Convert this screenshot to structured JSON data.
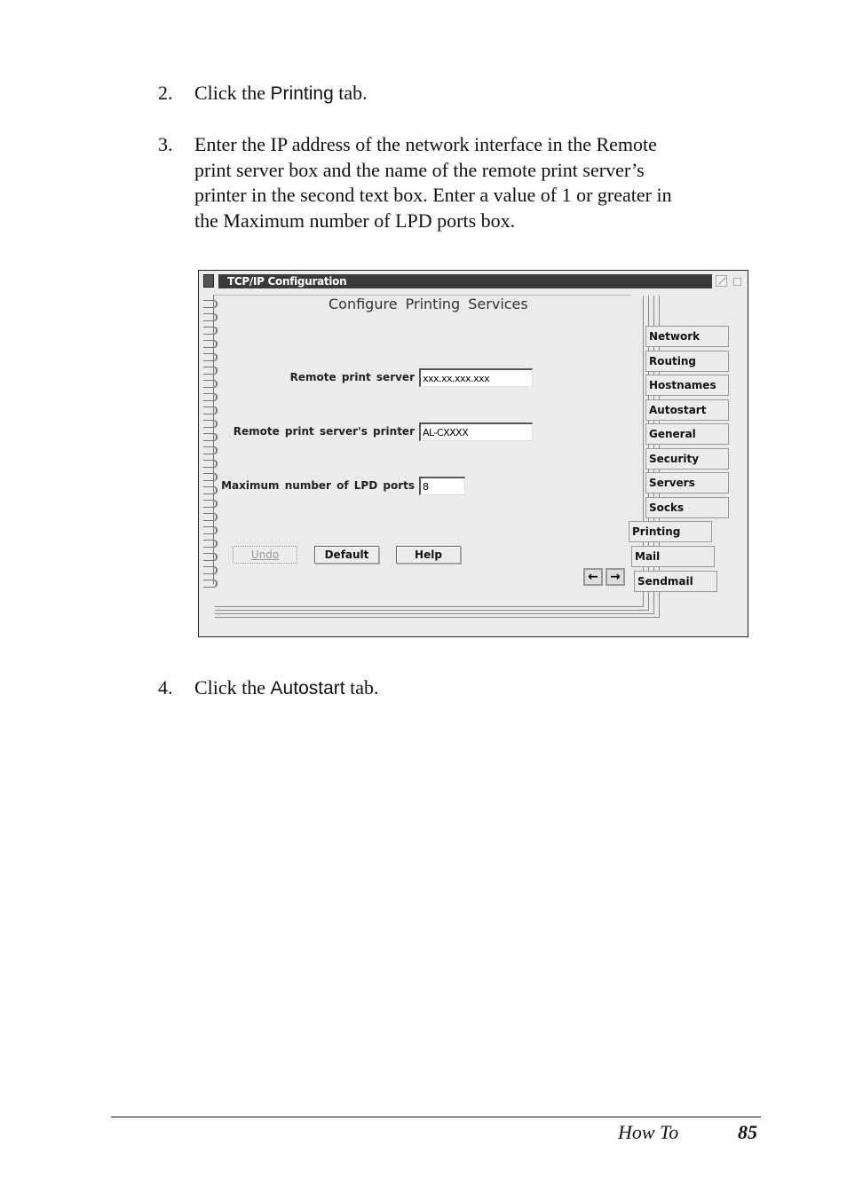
{
  "steps": [
    {
      "number": "2.",
      "lines": [
        "Click the ",
        "Printing",
        " tab."
      ]
    },
    {
      "number": "3.",
      "lines": [
        "Enter the IP address of the network interface in the Remote",
        "print server box and the name of the remote print server’s",
        "printer in the second text box. Enter a value of 1 or greater in",
        "the Maximum number of LPD ports box."
      ]
    },
    {
      "number": "4.",
      "lines": [
        "Click the ",
        "Autostart",
        " tab."
      ]
    }
  ],
  "window": {
    "title": "TCP/IP Configuration",
    "page_heading": "Configure  Printing  Services",
    "fields": [
      {
        "label": "Remote print server",
        "value": "xxx.xx.xxx.xxx"
      },
      {
        "label": "Remote print server's printer",
        "value": "AL-CXXXX"
      },
      {
        "label": "Maximum number of LPD ports",
        "value": "8"
      }
    ],
    "buttons": {
      "undo": "Undo",
      "default": "Default",
      "help": "Help"
    },
    "tabs": [
      "Network",
      "Routing",
      "Hostnames",
      "Autostart",
      "General",
      "Security",
      "Servers",
      "Socks",
      "Printing",
      "Mail",
      "Sendmail"
    ],
    "active_tab": "Printing",
    "arrows": {
      "prev": "←",
      "next": "→"
    }
  },
  "footer": {
    "section": "How To",
    "page": "85"
  }
}
